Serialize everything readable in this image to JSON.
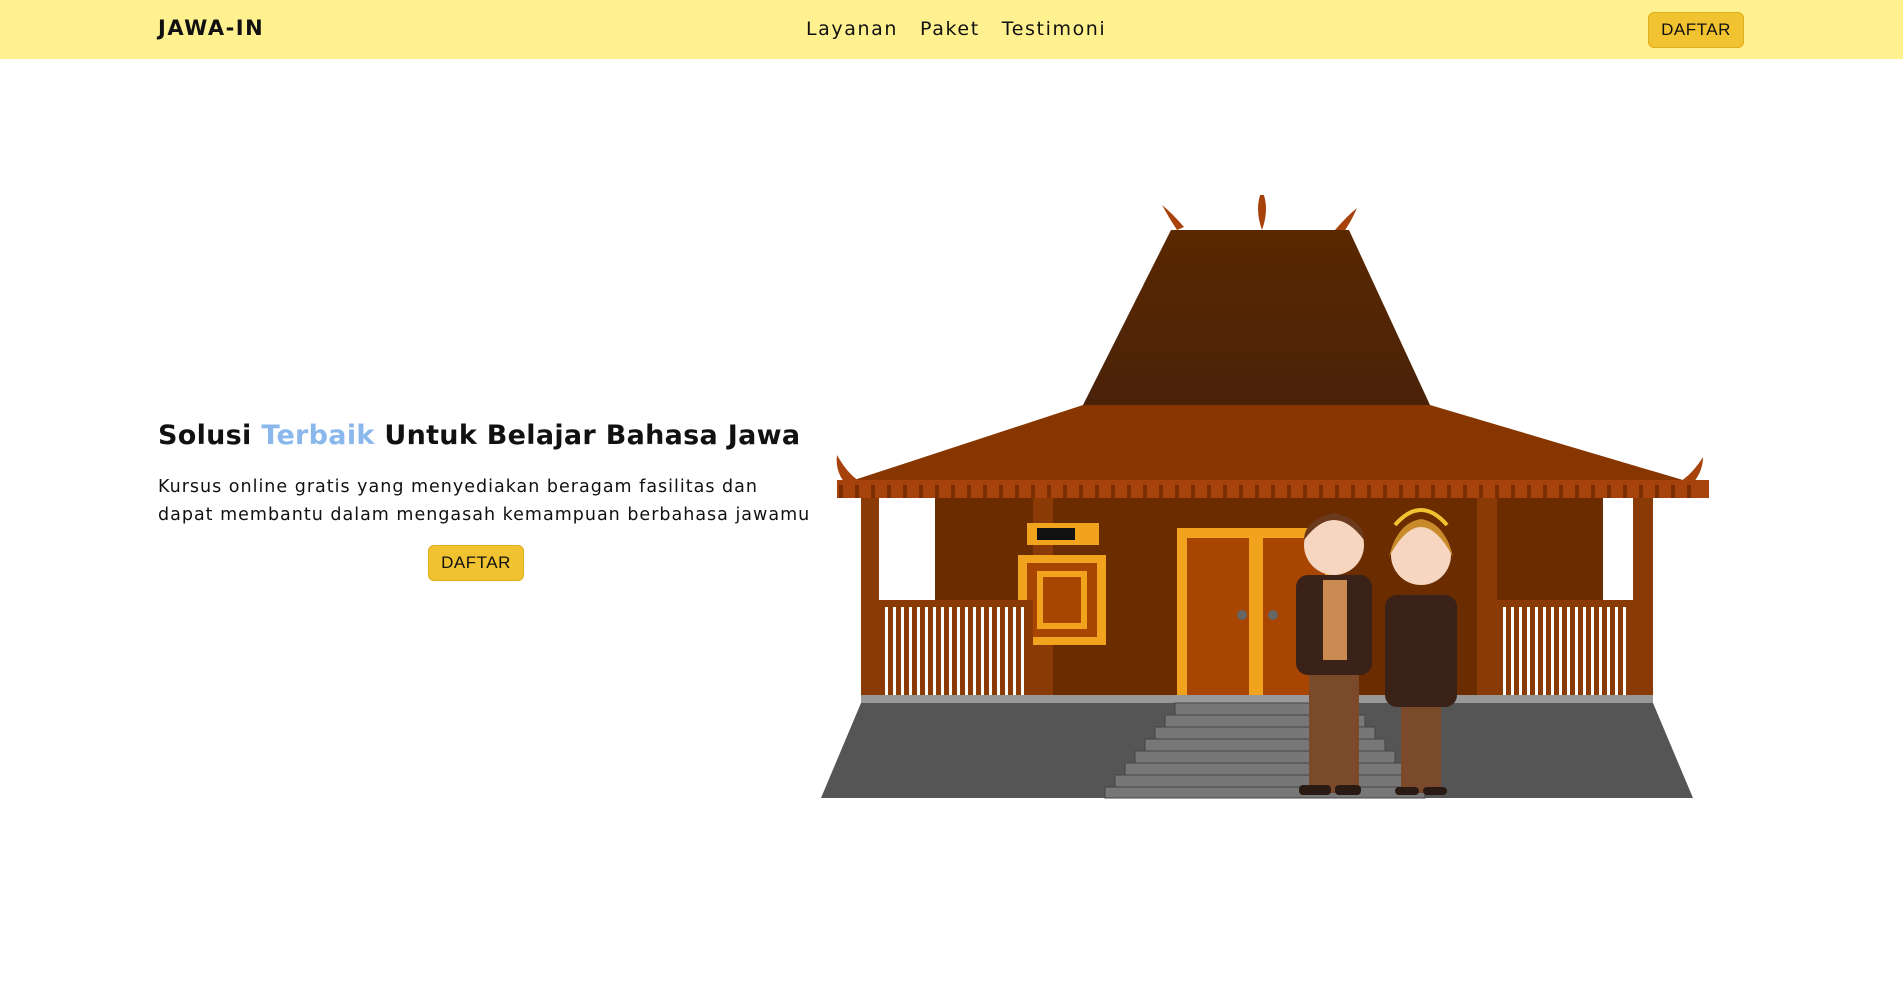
{
  "navbar": {
    "brand": "JAWA-IN",
    "links": [
      "Layanan",
      "Paket",
      "Testimoni"
    ],
    "cta_label": "DAFTAR"
  },
  "hero": {
    "title_before": "Solusi ",
    "title_accent": "Terbaik",
    "title_after": " Untuk Belajar Bahasa Jawa",
    "description": "Kursus online gratis yang menyediakan beragam fasilitas dan dapat membantu dalam mengasah kemampuan berbahasa jawamu",
    "cta_label": "DAFTAR"
  },
  "colors": {
    "navbar_bg": "#fff18f",
    "button": "#f2c330",
    "accent_text": "#8ab8ec"
  },
  "illustration": {
    "name": "joglo-house-with-javanese-couple"
  }
}
